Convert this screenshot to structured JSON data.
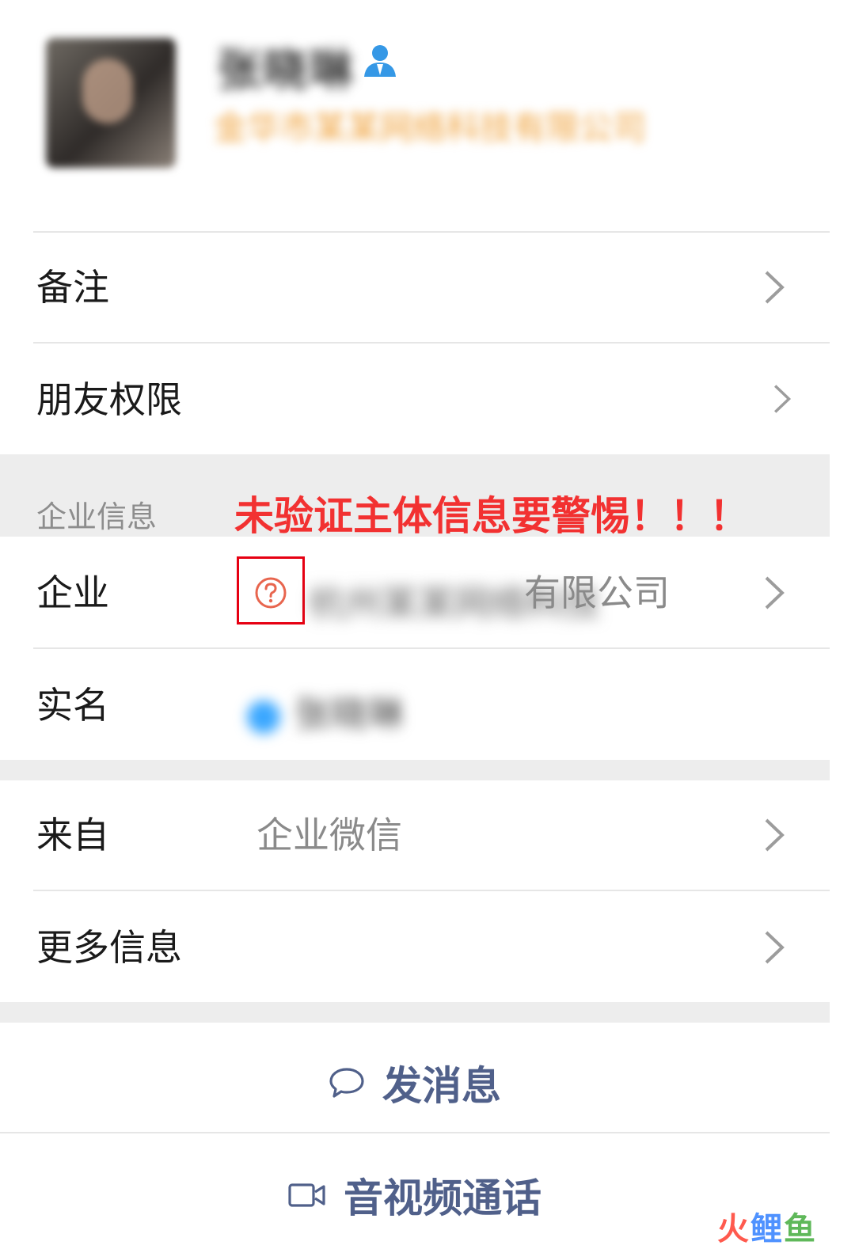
{
  "profile": {
    "name": "张晓琳",
    "company": "金华市某某网络科技有限公司"
  },
  "rows": {
    "remark": "备注",
    "friend_permission": "朋友权限",
    "enterprise_section": "企业信息",
    "warning": "未验证主体信息要警惕！！！",
    "enterprise": "企业",
    "enterprise_value_blurred": "杭州某某网络科技",
    "enterprise_value_suffix": "有限公司",
    "real_name": "实名",
    "real_name_value_blurred": "张晓琳",
    "from": "来自",
    "from_value": "企业微信",
    "more_info": "更多信息"
  },
  "actions": {
    "send_message": "发消息",
    "av_call": "音视频通话"
  },
  "watermark": {
    "part1": "火",
    "part2": "鲤",
    "part3": "鱼"
  },
  "colors": {
    "warning": "#f23131",
    "link": "#50608a",
    "highlight_box": "#e60012"
  }
}
